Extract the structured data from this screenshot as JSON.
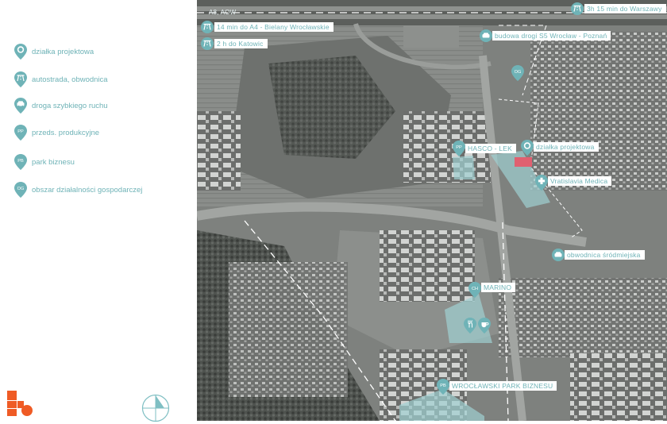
{
  "legend": {
    "items": [
      {
        "icon": "pin-location-icon",
        "label": "działka projektowa"
      },
      {
        "icon": "highway-icon",
        "label": "autostrada, obwodnica"
      },
      {
        "icon": "car-icon",
        "label": "droga szybkiego ruchu"
      },
      {
        "icon": "pp-badge-icon",
        "code": "PP",
        "label": "przeds. produkcyjne"
      },
      {
        "icon": "pb-badge-icon",
        "code": "PB",
        "label": "park biznesu"
      },
      {
        "icon": "og-badge-icon",
        "code": "OG",
        "label": "obszar działalności gospodarczej"
      }
    ]
  },
  "map": {
    "road_label": "A8, AOW",
    "callouts": {
      "warszawa": "3h 15 min do Warszawy",
      "bielany": "14 min do A4 - Bielany Wrocławskie",
      "katowice": "2 h do Katowic",
      "s5": "budowa drogi S5 Wrocław - Poznań",
      "hasco": "HASCO - LEK",
      "dzialka": "działka projektowa",
      "vratislavia": "Vratislavia Medica",
      "obwodnica": "obwodnica śródmiejska",
      "marino": "MARINO",
      "park": "WROCŁAWSKI PARK BIZNESU"
    },
    "badges": {
      "og": "OG",
      "pp": "PP",
      "ch": "CH",
      "pb": "PB"
    }
  },
  "colors": {
    "accent": "#6fb3b7",
    "zone_fill": "#9fd0d2",
    "plot_marker": "#e06070",
    "logo": "#ef5b25"
  }
}
